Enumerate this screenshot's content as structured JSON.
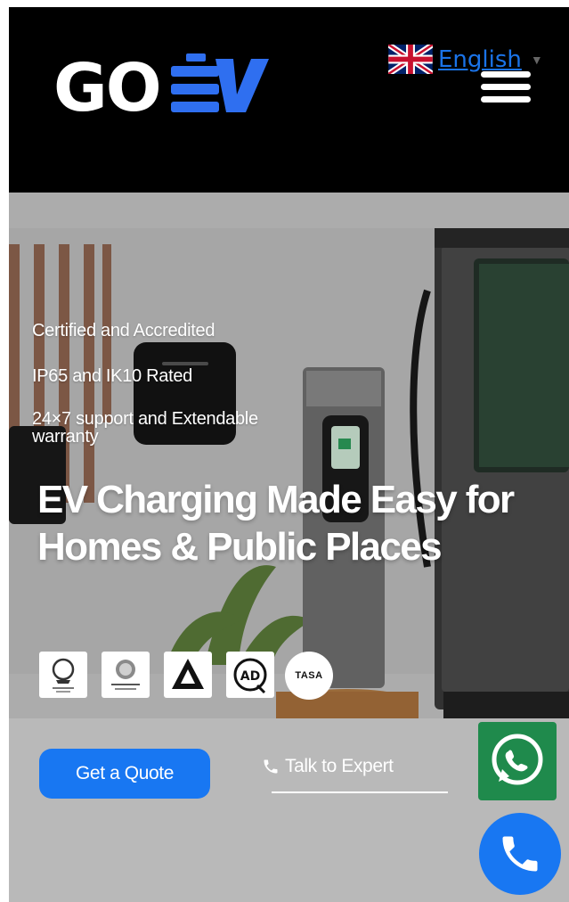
{
  "header": {
    "logo": {
      "text_left": "GO",
      "text_right": "V",
      "brand": "GO EV"
    },
    "language": {
      "label": "English",
      "flag": "uk-flag-icon"
    },
    "menu_icon": "hamburger-menu-icon"
  },
  "hero": {
    "features": [
      "Certified and Accredited",
      "IP65 and IK10 Rated",
      "24×7 support and Extendable warranty"
    ],
    "headline": "EV Charging Made Easy for Homes & Public Places",
    "certifications": [
      {
        "name": "dubai-municipality-logo"
      },
      {
        "name": "dewa-logo"
      },
      {
        "name": "dmt-logo"
      },
      {
        "name": "adq-logo"
      },
      {
        "name": "tasa-logo",
        "text": "TASA"
      }
    ],
    "cta": {
      "quote_label": "Get a Quote",
      "talk_label": "Talk to Expert"
    }
  },
  "floating": {
    "whatsapp_icon": "whatsapp-icon",
    "call_icon": "phone-icon"
  },
  "colors": {
    "brand_blue": "#1877f2",
    "logo_blue": "#2f6ff0",
    "whatsapp_green": "#1f8a4c",
    "header_bg": "#000000"
  }
}
